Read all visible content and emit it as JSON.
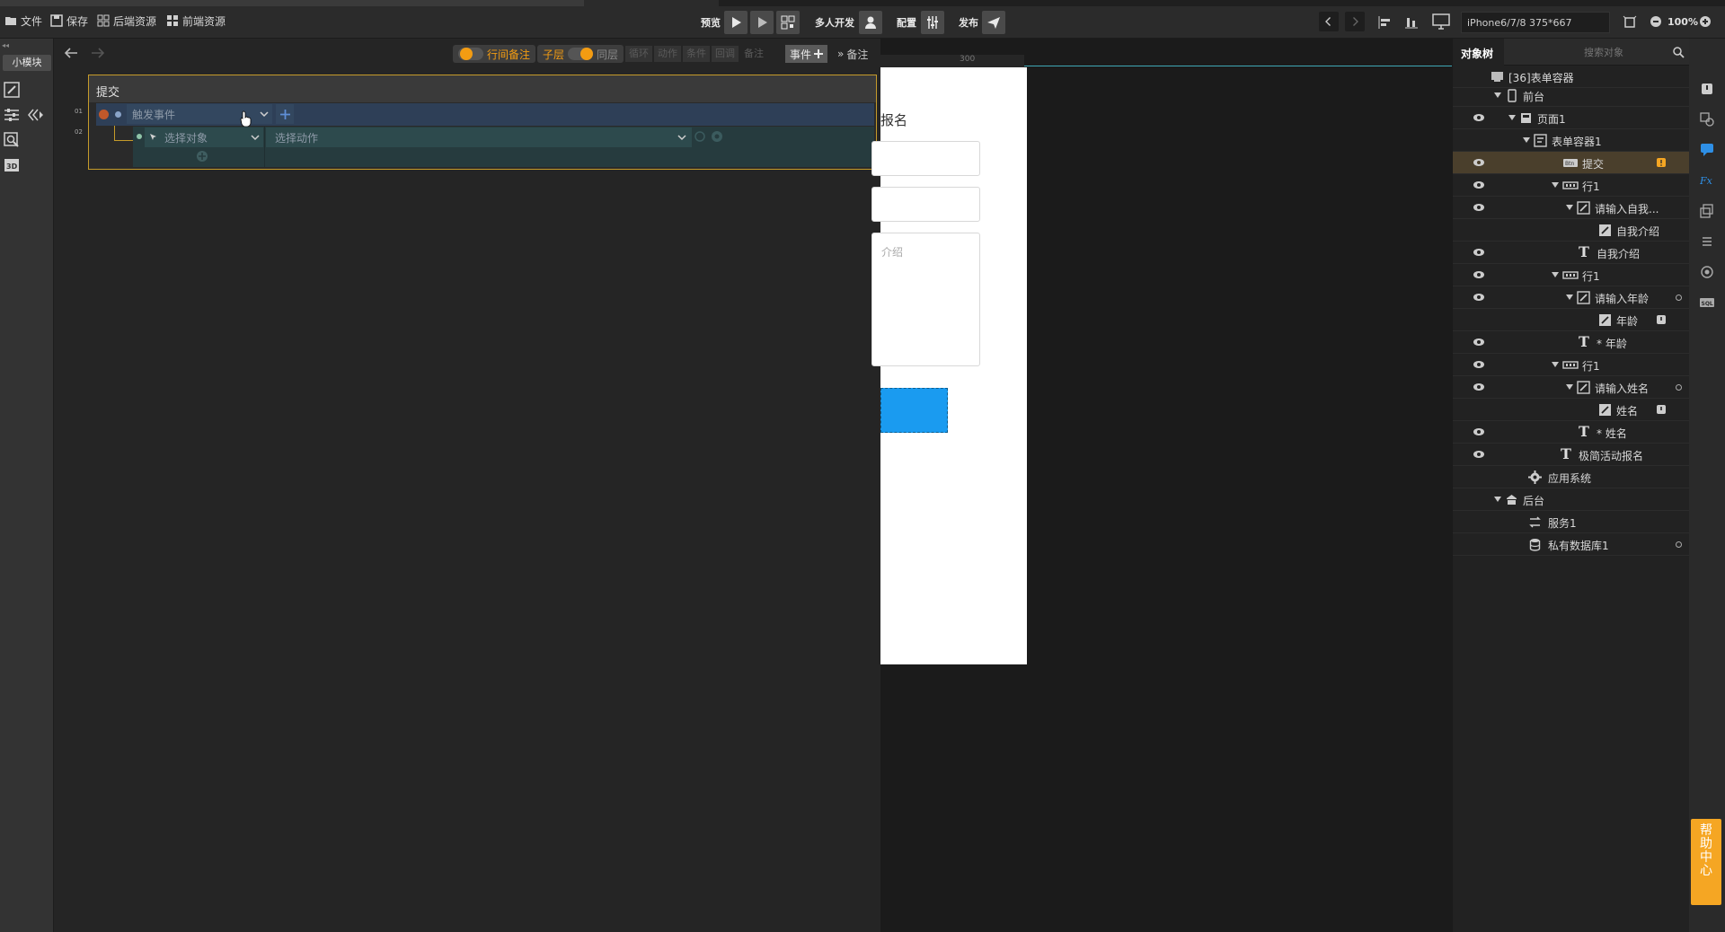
{
  "topbar": {
    "file": "文件",
    "save": "保存",
    "backend_res": "后端资源",
    "frontend_res": "前端资源",
    "preview": "预览",
    "multi_dev": "多人开发",
    "config": "配置",
    "publish": "发布",
    "device": "iPhone6/7/8 375*667",
    "zoom": "100%"
  },
  "left": {
    "module_tab": "小模块"
  },
  "event_editor": {
    "row_note": "行间备注",
    "child_layer": "子层",
    "same_layer": "同层",
    "chips": [
      "循环",
      "动作",
      "条件",
      "回调",
      "备注"
    ],
    "event_btn": "事件",
    "note_btn": "备注",
    "box_title": "提交",
    "line1_no": "01",
    "line2_no": "02",
    "trigger_placeholder": "触发事件",
    "select_object": "选择对象",
    "select_action": "选择动作"
  },
  "canvas": {
    "ruler_label": "300",
    "form_title": "报名",
    "textarea_placeholder": "介绍"
  },
  "right_panel": {
    "tab_tree": "对象树",
    "search_placeholder": "搜索对象",
    "tree": [
      {
        "label": "[36]表单容器"
      },
      {
        "label": "前台"
      },
      {
        "label": "页面1"
      },
      {
        "label": "表单容器1"
      },
      {
        "label": "提交"
      },
      {
        "label": "行1"
      },
      {
        "label": "请输入自我..."
      },
      {
        "label": "自我介绍"
      },
      {
        "label": "自我介绍"
      },
      {
        "label": "行1"
      },
      {
        "label": "请输入年龄"
      },
      {
        "label": "年龄"
      },
      {
        "label": "* 年龄"
      },
      {
        "label": "行1"
      },
      {
        "label": "请输入姓名"
      },
      {
        "label": "姓名"
      },
      {
        "label": "* 姓名"
      },
      {
        "label": "极简活动报名"
      },
      {
        "label": "应用系统"
      },
      {
        "label": "后台"
      },
      {
        "label": "服务1"
      },
      {
        "label": "私有数据库1"
      }
    ]
  },
  "help": "帮助中心",
  "colors": {
    "accent_orange": "#f39c12",
    "selection_blue": "#1a9bf0",
    "event_border": "#c59b2a"
  }
}
